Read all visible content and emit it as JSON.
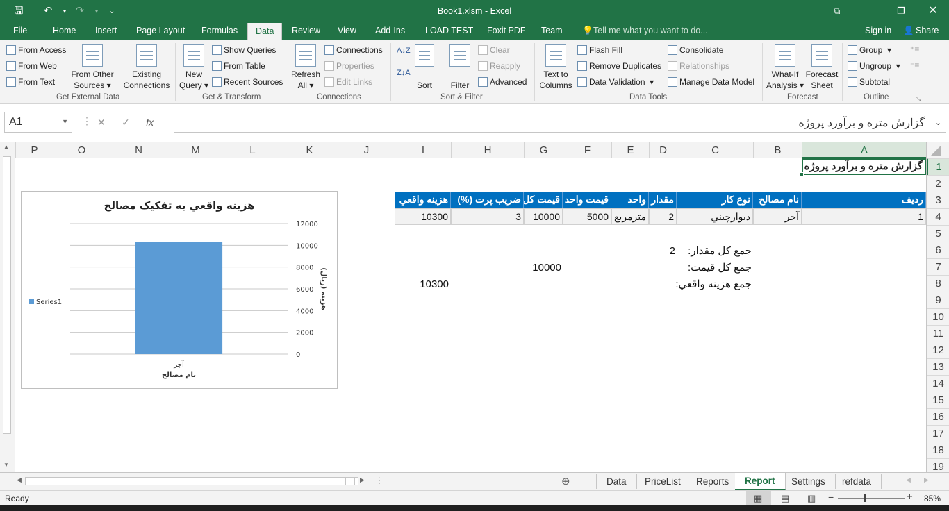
{
  "window": {
    "title": "Book1.xlsm - Excel",
    "qat": {
      "save": "save-icon",
      "undo": "undo-icon",
      "redo": "redo-icon",
      "customize": "customize-qat-icon"
    },
    "controls": {
      "ribbon_display": "ribbon-display-icon",
      "minimize": "minimize-icon",
      "restore": "restore-icon",
      "close": "close-icon"
    }
  },
  "ribbon_tabs": [
    "File",
    "Home",
    "Insert",
    "Page Layout",
    "Formulas",
    "Data",
    "Review",
    "View",
    "Add-Ins",
    "LOAD TEST",
    "Foxit PDF",
    "Team"
  ],
  "active_tab": "Data",
  "tell_me": "Tell me what you want to do...",
  "account": {
    "sign_in": "Sign in",
    "share": "Share"
  },
  "ribbon": {
    "get_external_data": {
      "label": "Get External Data",
      "from_access": "From Access",
      "from_web": "From Web",
      "from_text": "From Text",
      "from_other_1": "From Other",
      "from_other_2": "Sources",
      "existing_1": "Existing",
      "existing_2": "Connections"
    },
    "get_transform": {
      "label": "Get & Transform",
      "new_query_1": "New",
      "new_query_2": "Query",
      "show_queries": "Show Queries",
      "from_table": "From Table",
      "recent_sources": "Recent Sources"
    },
    "connections": {
      "label": "Connections",
      "refresh_1": "Refresh",
      "refresh_2": "All",
      "connections": "Connections",
      "properties": "Properties",
      "edit_links": "Edit Links"
    },
    "sort_filter": {
      "label": "Sort & Filter",
      "sort": "Sort",
      "filter": "Filter",
      "clear": "Clear",
      "reapply": "Reapply",
      "advanced": "Advanced"
    },
    "data_tools": {
      "label": "Data Tools",
      "text_to_1": "Text to",
      "text_to_2": "Columns",
      "flash_fill": "Flash Fill",
      "remove_duplicates": "Remove Duplicates",
      "data_validation": "Data Validation",
      "consolidate": "Consolidate",
      "relationships": "Relationships",
      "manage_data_model": "Manage Data Model"
    },
    "forecast": {
      "label": "Forecast",
      "whatif_1": "What-If",
      "whatif_2": "Analysis",
      "forecast_1": "Forecast",
      "forecast_2": "Sheet"
    },
    "outline": {
      "label": "Outline",
      "group": "Group",
      "ungroup": "Ungroup",
      "subtotal": "Subtotal"
    }
  },
  "formula_bar": {
    "name_box": "A1",
    "fx": "fx",
    "cancel": "✕",
    "enter": "✓",
    "content": "گزارش متره و برآورد پروژه"
  },
  "columns": [
    "P",
    "O",
    "N",
    "M",
    "L",
    "K",
    "J",
    "I",
    "H",
    "G",
    "F",
    "E",
    "D",
    "C",
    "B",
    "A"
  ],
  "rows": [
    "1",
    "2",
    "3",
    "4",
    "5",
    "6",
    "7",
    "8",
    "9",
    "10",
    "11",
    "12",
    "13",
    "14",
    "15",
    "16",
    "17",
    "18",
    "19"
  ],
  "sheet": {
    "a1": "گزارش متره و برآورد پروژه",
    "headers": {
      "A": "رديف",
      "B": "نام مصالح",
      "C": "نوع كار",
      "D": "مقدار",
      "E": "واحد",
      "F": "قيمت واحد",
      "G": "قيمت كل",
      "H": "ضريب پرت (%)",
      "I": "هزينه واقعي"
    },
    "row4": {
      "A": "1",
      "B": "آجر",
      "C": "ديوارچيني",
      "D": "2",
      "E": "مترمربع",
      "F": "5000",
      "G": "10000",
      "H": "3",
      "I": "10300"
    },
    "summary": {
      "qty_label": "جمع كل مقدار:",
      "qty_value": "2",
      "price_label": "جمع كل قيمت:",
      "price_value": "10000",
      "cost_label": "جمع هزينه واقعي:",
      "cost_value": "10300"
    }
  },
  "chart_data": {
    "type": "bar",
    "title": "هزينه واقعي به تفكيک مصالح",
    "categories": [
      "آجر"
    ],
    "series": [
      {
        "name": "Series1",
        "values": [
          10300
        ],
        "color": "#5b9bd5"
      }
    ],
    "xlabel": "نام مصالح",
    "ylabel": "هزينه (ريال)",
    "ylim": [
      0,
      12000
    ],
    "yticks": [
      0,
      2000,
      4000,
      6000,
      8000,
      10000,
      12000
    ],
    "legend": "left",
    "grid": true
  },
  "sheet_tabs": [
    "Data",
    "PriceList",
    "Reports",
    "Report",
    "Settings",
    "refdata"
  ],
  "active_sheet": "Report",
  "status": {
    "ready": "Ready",
    "zoom": "85%"
  }
}
